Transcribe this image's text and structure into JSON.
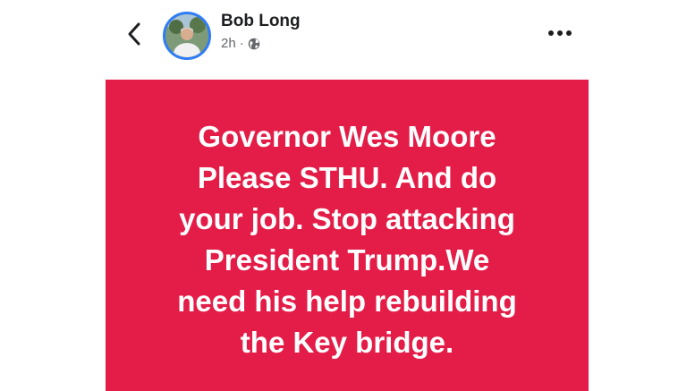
{
  "post": {
    "author": "Bob Long",
    "timestamp": "2h",
    "audience_icon": "globe-icon",
    "background_color": "#e31d48",
    "text": "Governor Wes Moore\nPlease STHU. And do\nyour job. Stop attacking\nPresident Trump.We\nneed his help rebuilding\nthe Key bridge."
  },
  "header": {
    "back_icon": "chevron-left-icon",
    "more_icon": "ellipsis-icon"
  }
}
